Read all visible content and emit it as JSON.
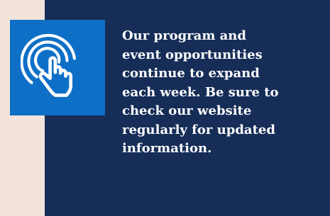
{
  "message": {
    "text": "Our program and\nevent opportunities\ncontinue to expand\neach week. Be sure to\ncheck our website\nregularly for updated\ninformation."
  },
  "icon": {
    "name": "touch-hand-icon",
    "tile_color": "#0e6fc6",
    "stroke_color": "#ffffff"
  },
  "colors": {
    "page_background": "#f3e4db",
    "panel_background": "#162d57",
    "text": "#ffffff"
  }
}
